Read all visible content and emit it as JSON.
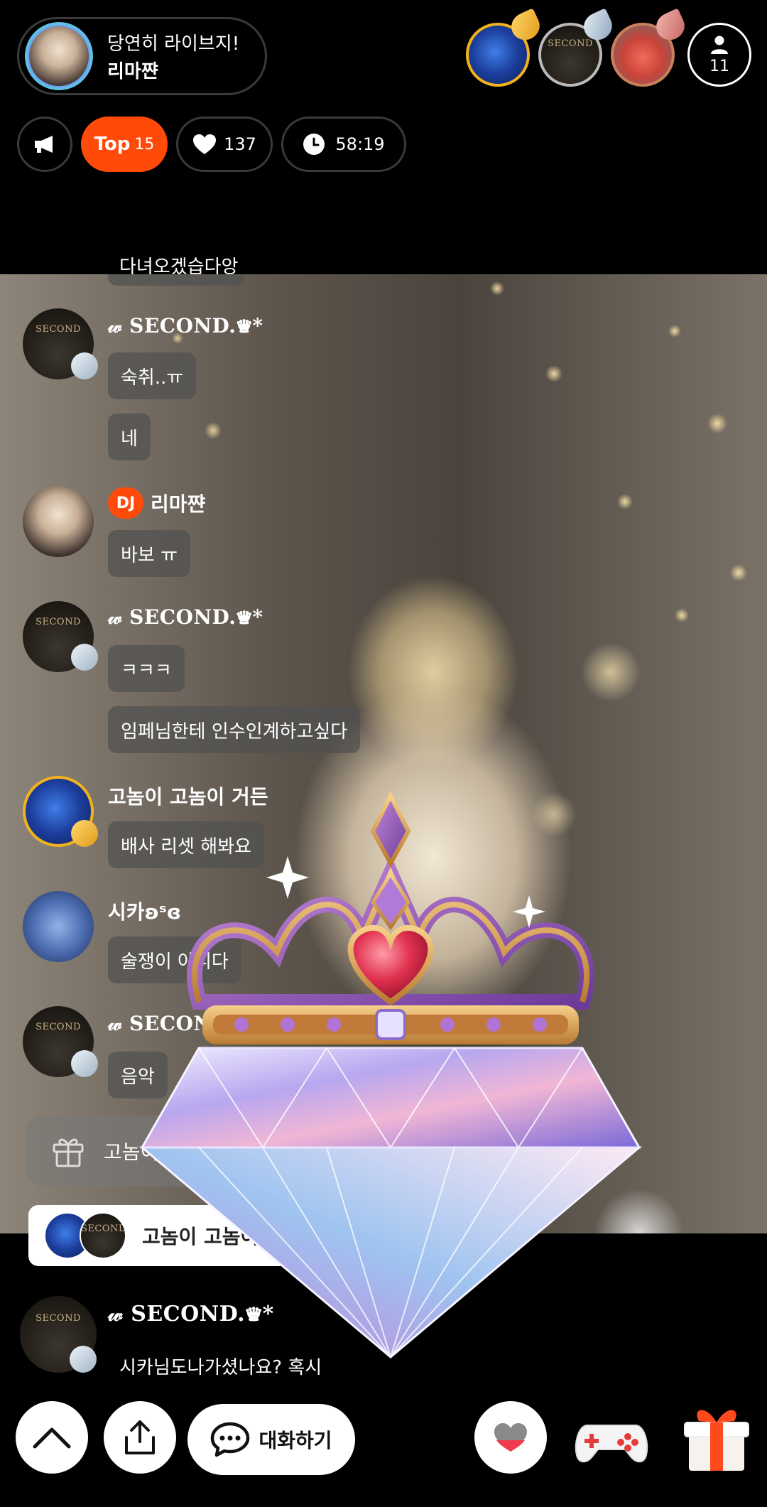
{
  "header": {
    "stream_title": "당연히 라이브지!",
    "streamer_name": "리마쨘",
    "viewer_count": "11"
  },
  "status": {
    "top_label": "Top",
    "top_rank": "15",
    "likes": "137",
    "elapsed": "58:19"
  },
  "chat": {
    "partial_top": "다녀오겠습다앙",
    "messages": [
      {
        "nick": "𝓌 SECOND.♛*",
        "texts": [
          "숙취..ㅠ",
          "네"
        ]
      },
      {
        "nick": "리마쨘",
        "badge": "DJ",
        "texts": [
          "바보 ㅠ"
        ]
      },
      {
        "nick": "𝓌 SECOND.♛*",
        "texts": [
          "ㅋㅋㅋ",
          "임페님한테 인수인계하고싶다"
        ]
      },
      {
        "nick": "고놈이 고놈이 거든",
        "texts": [
          "배사 리셋 해봐요"
        ]
      },
      {
        "nick": "시카ʚˢɞ",
        "texts": [
          "술쟁이 아니다"
        ]
      },
      {
        "nick": "𝓌 SECOND",
        "texts": [
          "음악"
        ]
      }
    ],
    "gift_notice": "고놈이 고",
    "entry_toast": "고놈이 고놈이 ",
    "last_message": {
      "nick": "𝓌 SECOND.♛*",
      "text": "시카님도나가셨나요? 혹시"
    }
  },
  "bottom": {
    "chat_button_label": "대화하기"
  },
  "icons": {
    "notice": "megaphone-icon",
    "likes": "heart-icon",
    "timer": "clock-icon",
    "viewers": "person-icon",
    "scroll_up": "chevron-up-icon",
    "share": "share-icon",
    "chat": "chat-bubble-icon",
    "like_send": "heart-icon",
    "game": "gamepad-icon",
    "gift": "gift-box-icon"
  },
  "colors": {
    "accent": "#ff4a0a",
    "gold_rank": "#f2b21c",
    "silver_rank": "#b9b9b9",
    "bronze_rank": "#c9805a"
  }
}
